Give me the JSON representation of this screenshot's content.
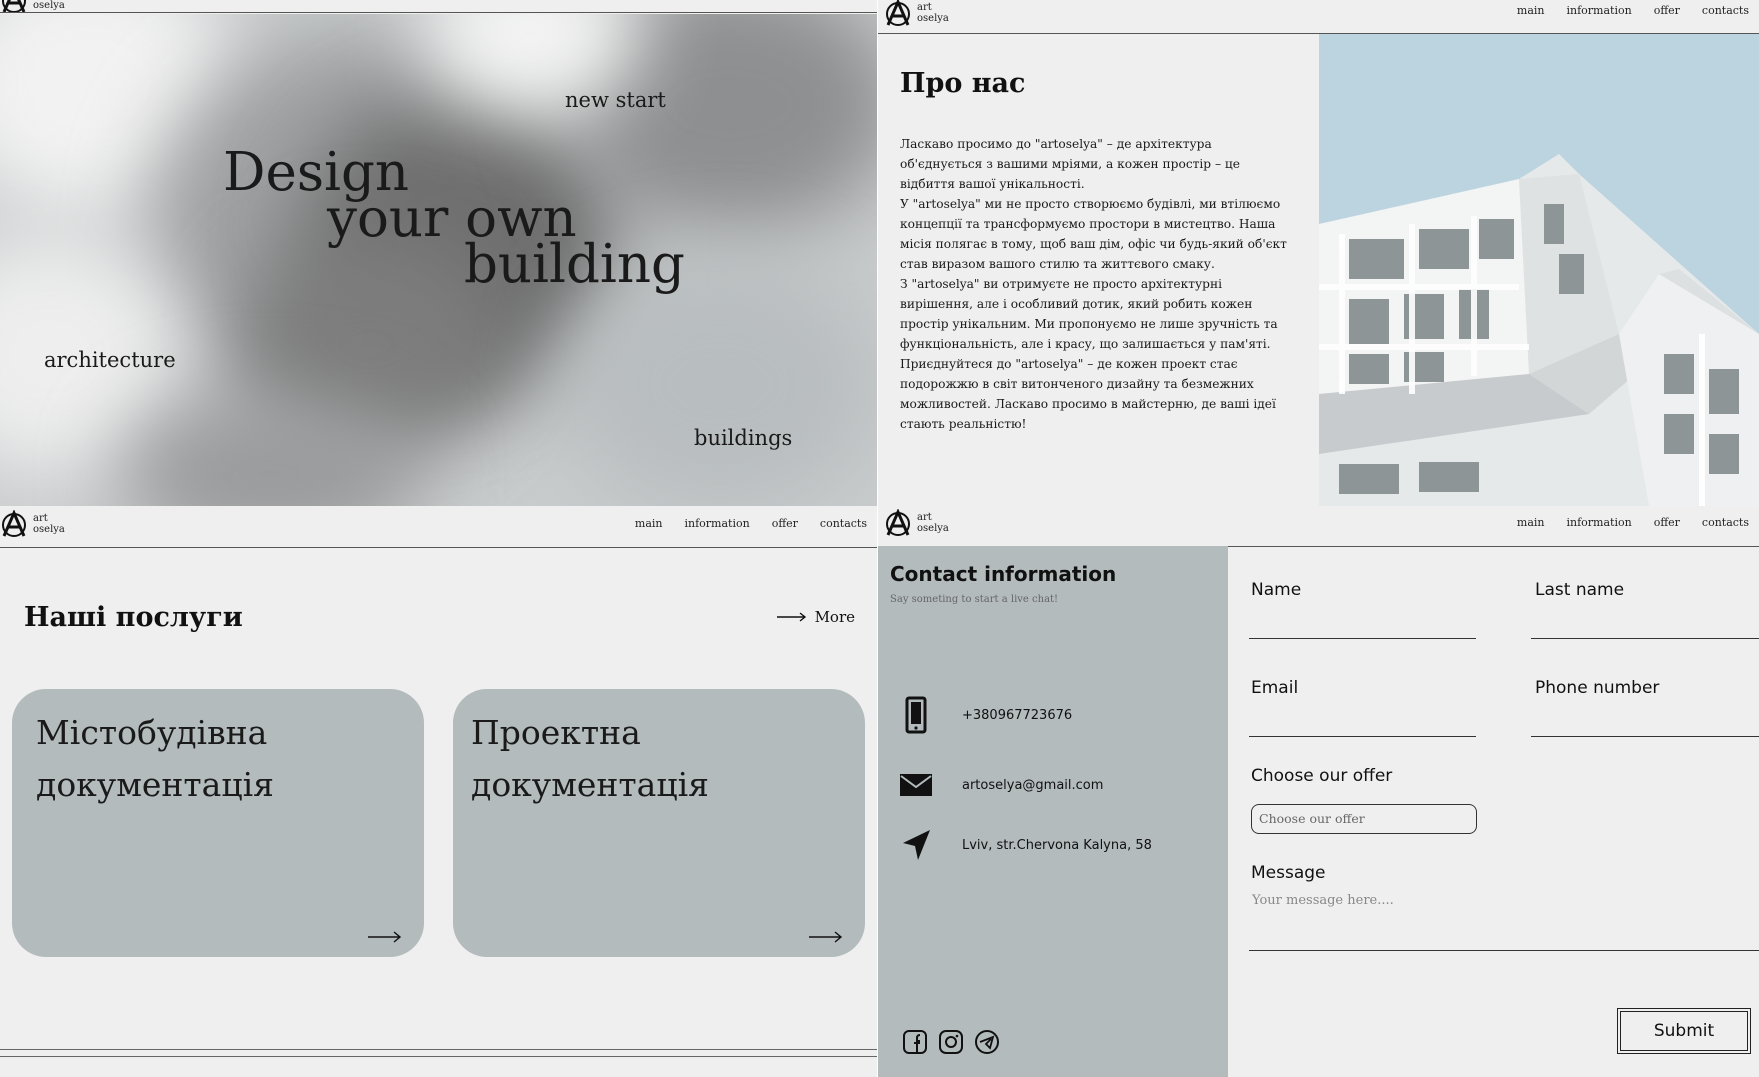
{
  "brand": {
    "line1": "art",
    "line2": "oselya"
  },
  "nav": [
    "main",
    "information",
    "offer",
    "contacts"
  ],
  "hero": {
    "line1": "Design",
    "line2": "your own",
    "line3": "building",
    "word_new_start": "new start",
    "word_architecture": "architecture",
    "word_buildings": "buildings"
  },
  "about": {
    "title": "Про нас",
    "paragraphs": [
      "Ласкаво просимо до \"artoselya\" – де архітектура об'єднується з вашими мріями, а кожен простір – це відбиття вашої унікальності.",
      "У \"artoselya\" ми не просто створюємо будівлі, ми втілюємо концепції та трансформуємо простори в мистецтво. Наша місія полягає в тому, щоб ваш дім, офіс чи будь-який об'єкт став виразом вашого стилю та життєвого смаку.",
      "З \"artoselya\" ви отримуєте не просто архітектурні вирішення, але і особливий дотик, який робить кожен простір унікальним. Ми пропонуємо не лише зручність та функціональність, але і красу, що залишається у пам'яті.",
      "Приєднуйтеся до \"artoselya\" – де кожен проект стає подорожжю в світ витонченого дизайну та безмежних можливостей. Ласкаво просимо в майстерню, де ваші ідеї стають реальністю!"
    ]
  },
  "services": {
    "title": "Наші послуги",
    "more_label": "More",
    "cards": [
      {
        "line1": "Містобудівна",
        "line2": "документація"
      },
      {
        "line1": "Проектна",
        "line2": "документація"
      }
    ]
  },
  "contact": {
    "title": "Contact information",
    "subtitle": "Say someting to start a live chat!",
    "phone": "+380967723676",
    "email": "artoselya@gmail.com",
    "address": "Lviv, str.Chervona Kalyna, 58",
    "social_icons": [
      "facebook-icon",
      "instagram-icon",
      "telegram-icon"
    ]
  },
  "form": {
    "name_label": "Name",
    "last_name_label": "Last name",
    "email_label": "Email",
    "phone_label": "Phone number",
    "offer_label": "Choose our offer",
    "offer_placeholder": "Choose our offer",
    "message_label": "Message",
    "message_placeholder": "Your message here....",
    "submit_label": "Submit"
  },
  "colors": {
    "background": "#efefef",
    "card": "#b3bbbd",
    "sky": "#bcd4e0",
    "text": "#111111"
  }
}
